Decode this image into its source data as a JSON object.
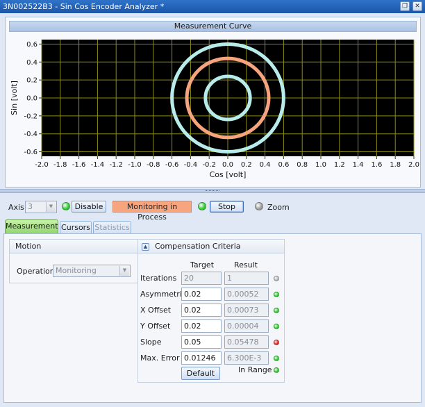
{
  "window": {
    "title": "3N002522B3 - Sin Cos Encoder Analyzer *",
    "restore_glyph": "❐",
    "close_glyph": "✕"
  },
  "chart_panel": {
    "header": "Measurement Curve"
  },
  "chart_data": {
    "type": "scatter",
    "subtype": "circular encoder trace (Lissajous)",
    "xlabel": "Cos [volt]",
    "ylabel": "Sin [volt]",
    "xlim": [
      -2.0,
      2.0
    ],
    "ylim": [
      -0.65,
      0.65
    ],
    "x_ticks": [
      "-2.0",
      "-1.8",
      "-1.6",
      "-1.4",
      "-1.2",
      "-1.0",
      "-0.8",
      "-0.6",
      "-0.4",
      "-0.2",
      "0.0",
      "0.2",
      "0.4",
      "0.6",
      "0.8",
      "1.0",
      "1.2",
      "1.4",
      "1.6",
      "1.8",
      "2.0"
    ],
    "y_ticks": [
      "0.6",
      "0.4",
      "0.2",
      "0.0",
      "-0.2",
      "-0.4",
      "-0.6"
    ],
    "grid": true,
    "plot_background": "#000000",
    "grid_color": "#8c8c14",
    "series": [
      {
        "center": [
          0.0,
          0.0
        ],
        "radius": 0.6,
        "color": "#b7ecea"
      },
      {
        "center": [
          0.0,
          0.0
        ],
        "radius": 0.44,
        "color": "#f6a47e"
      },
      {
        "center": [
          0.0,
          0.0
        ],
        "radius": 0.24,
        "color": "#b7ecea"
      }
    ]
  },
  "toolbar": {
    "axis_label": "Axis",
    "axis_value": "3",
    "axis_led_color": "#2fc92f",
    "disable_label": "Disable",
    "monitoring_label": "Monitoring in Process",
    "monitoring_color": "#f6a57e",
    "monitor_led_color": "#2fc92f",
    "stop_label": "Stop",
    "zoom_led_color": "#9a9a9a",
    "zoom_label": "Zoom"
  },
  "tabs": [
    {
      "label": "Measurement",
      "state": "active"
    },
    {
      "label": "Cursors",
      "state": "normal"
    },
    {
      "label": "Statistics",
      "state": "disabled"
    }
  ],
  "motion": {
    "header": "Motion",
    "operation_label": "Operation",
    "operation_value": "Monitoring"
  },
  "compensation": {
    "header": "Compensation Criteria",
    "col_target": "Target",
    "col_result": "Result",
    "rows": [
      {
        "label": "Iterations",
        "target": "20",
        "result": "1",
        "led": "#b5b5b5",
        "target_disabled": true
      },
      {
        "label": "Asymmetries",
        "target": "0.02",
        "result": "0.00052",
        "led": "#2fc92f",
        "target_disabled": false
      },
      {
        "label": "X Offset",
        "target": "0.02",
        "result": "0.00073",
        "led": "#2fc92f",
        "target_disabled": false
      },
      {
        "label": "Y Offset",
        "target": "0.02",
        "result": "0.00004",
        "led": "#2fc92f",
        "target_disabled": false
      },
      {
        "label": "Slope",
        "target": "0.05",
        "result": "0.05478",
        "led": "#e02020",
        "target_disabled": false
      },
      {
        "label": "Max. Error",
        "target": "0.01246",
        "result": "6.300E-3",
        "led": "#2fc92f",
        "target_disabled": false
      }
    ],
    "default_label": "Default",
    "in_range_label": "In Range",
    "in_range_led": "#2fc92f"
  }
}
